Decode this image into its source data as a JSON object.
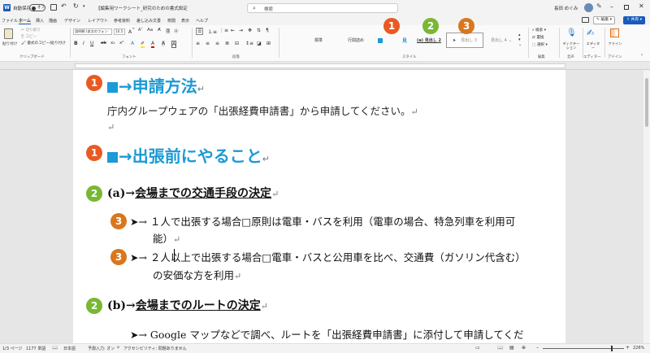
{
  "titlebar": {
    "autosave_label": "自動保存",
    "autosave_state": "オフ",
    "doc_title": "【編集用ワークシート_研究のための書式設定",
    "search_placeholder": "検索",
    "user_name": "長田 めぐみ"
  },
  "menu": {
    "tabs": [
      "ファイル",
      "ホーム",
      "挿入",
      "描画",
      "デザイン",
      "レイアウト",
      "参考資料",
      "差し込み文書",
      "校閲",
      "表示",
      "ヘルプ"
    ],
    "active_tab": "ホーム",
    "edit_mode": "編集",
    "share_label": "共有",
    "comment_icon": "comment-icon"
  },
  "ribbon": {
    "paste_label": "貼り付け",
    "cut_label": "切り取り",
    "copy_label": "コピー",
    "format_painter_label": "書式のコピー/貼り付け",
    "clipboard_group": "クリップボード",
    "font_name": "游明朝 (本文のフォン",
    "font_size": "10.5",
    "font_group": "フォント",
    "paragraph_group": "段落",
    "styles": [
      "標準",
      "行間詰め",
      "見",
      "(a) 見出し 2",
      "見出し 3",
      "見出し 4"
    ],
    "styles_group": "スタイル",
    "find_label": "検索",
    "replace_label": "置換",
    "select_label": "選択",
    "editing_group": "編集",
    "dictate_label": "ディクテーション",
    "voice_group": "音声",
    "editor_label": "エディター",
    "editor_group": "エディター",
    "addins_label": "アドイン",
    "addins_group": "アドイン"
  },
  "callouts": {
    "ribbon": [
      "1",
      "2",
      "3"
    ]
  },
  "document": {
    "h1_first": "→申請方法",
    "body1": "庁内グループウェアの「出張経費申請書」から申請してください。",
    "h1_second": "→出張前にやること",
    "h2_a_prefix": "(a)→",
    "h2_a_text": "会場までの交通手段の決定",
    "bullet1_line1": "➤→ １人で出張する場合□原則は電車・バスを利用（電車の場合、特急列車を利用可",
    "bullet1_line2": "能）",
    "bullet2_line1": "➤→ ２人以上で出張する場合□電車・バスと公用車を比べ、交通費（ガソリン代含む）",
    "bullet2_line2": "の安価な方を利用",
    "h2_b_prefix": "(b)→",
    "h2_b_text": "会場までのルートの決定",
    "bullet3_line1": "➤→ Google マップなどで調べ、ルートを「出張経費申請書」に添付して申請してくだ",
    "para_mark": "↵",
    "callout_nums": {
      "one": "1",
      "two": "2",
      "three": "3"
    }
  },
  "status": {
    "page": "1/3 ページ",
    "words": "1177 単語",
    "language": "日本語",
    "predict": "予測入力: オン",
    "accessibility": "アクセシビリティ: 問題ありません",
    "zoom": "226%"
  },
  "colors": {
    "heading1": "#1a9ad6",
    "callout1": "#e85a23",
    "callout2": "#78b833",
    "callout3": "#d9771f",
    "accent": "#185abd"
  }
}
